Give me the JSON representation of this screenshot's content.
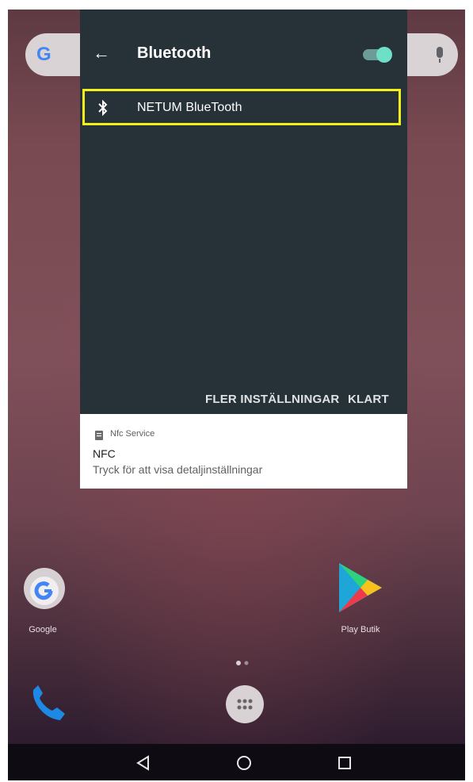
{
  "panel": {
    "title": "Bluetooth",
    "toggle_on": true,
    "device_name": "NETUM BlueTooth",
    "more_settings_label": "FLER INSTÄLLNINGAR",
    "done_label": "KLART"
  },
  "notification": {
    "app_name": "Nfc Service",
    "title": "NFC",
    "text": "Tryck för att visa detaljinställningar"
  },
  "home": {
    "apps": [
      {
        "label": "Google"
      },
      {
        "label": "Play Butik"
      }
    ]
  },
  "icons": [
    "back-arrow-icon",
    "bluetooth-icon",
    "nfc-icon",
    "google-icon",
    "mic-icon",
    "play-store-icon",
    "phone-icon",
    "app-drawer-icon",
    "back-nav-icon",
    "home-nav-icon",
    "recents-nav-icon"
  ],
  "colors": {
    "panel_bg": "#263238",
    "toggle_accent": "#6fe0c8",
    "highlight_border": "#f5f01a"
  }
}
